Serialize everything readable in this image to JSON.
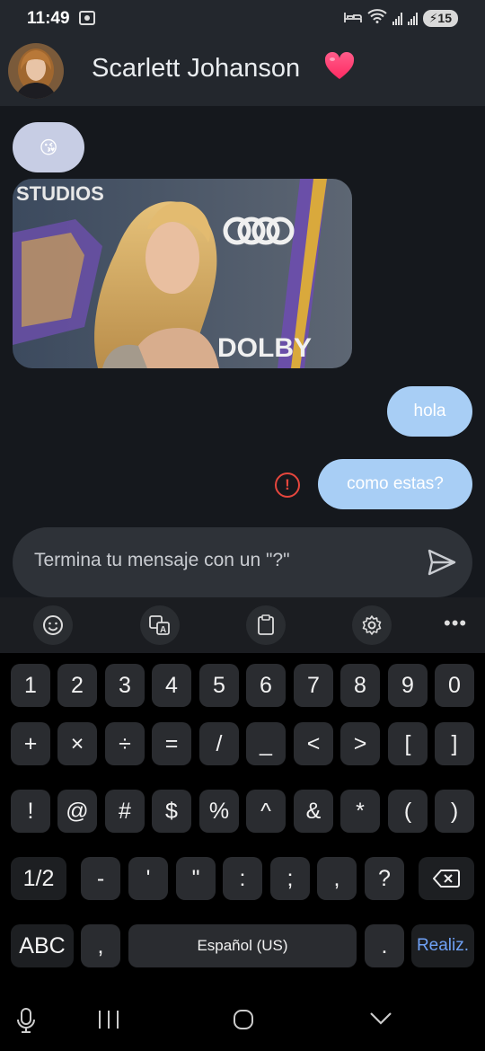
{
  "status_bar": {
    "time": "11:49",
    "battery": "15"
  },
  "header": {
    "contact_name": "Scarlett Johanson",
    "heart_icon": "heart-emoji"
  },
  "messages": [
    {
      "direction": "in",
      "type": "emoji",
      "content": "😘"
    },
    {
      "direction": "in",
      "type": "image",
      "content": "photo-of-woman-at-premiere"
    },
    {
      "direction": "out",
      "type": "text",
      "content": "hola"
    },
    {
      "direction": "out",
      "type": "text",
      "content": "como estas?",
      "error": true
    }
  ],
  "input": {
    "placeholder": "Termina tu mensaje con un \"?\"",
    "value": ""
  },
  "keyboard": {
    "toolbar": [
      "emoji-icon",
      "translate-icon",
      "clipboard-icon",
      "settings-icon",
      "more-icon"
    ],
    "rows": [
      [
        "1",
        "2",
        "3",
        "4",
        "5",
        "6",
        "7",
        "8",
        "9",
        "0"
      ],
      [
        "+",
        "×",
        "÷",
        "=",
        "/",
        "_",
        "<",
        ">",
        "[",
        "]"
      ],
      [
        "!",
        "@",
        "#",
        "$",
        "%",
        "^",
        "&",
        "*",
        "(",
        ")"
      ],
      [
        "1/2",
        "-",
        "'",
        "\"",
        ":",
        ";",
        ",",
        "?",
        "⌫"
      ],
      [
        "ABC",
        ",",
        "Español (US)",
        ".",
        "Realiz."
      ]
    ]
  },
  "colors": {
    "outgoing_bubble": "#a8cef5",
    "incoming_bubble": "#c7cde4",
    "error": "#e5463d",
    "action_key": "#6fa1f5"
  }
}
